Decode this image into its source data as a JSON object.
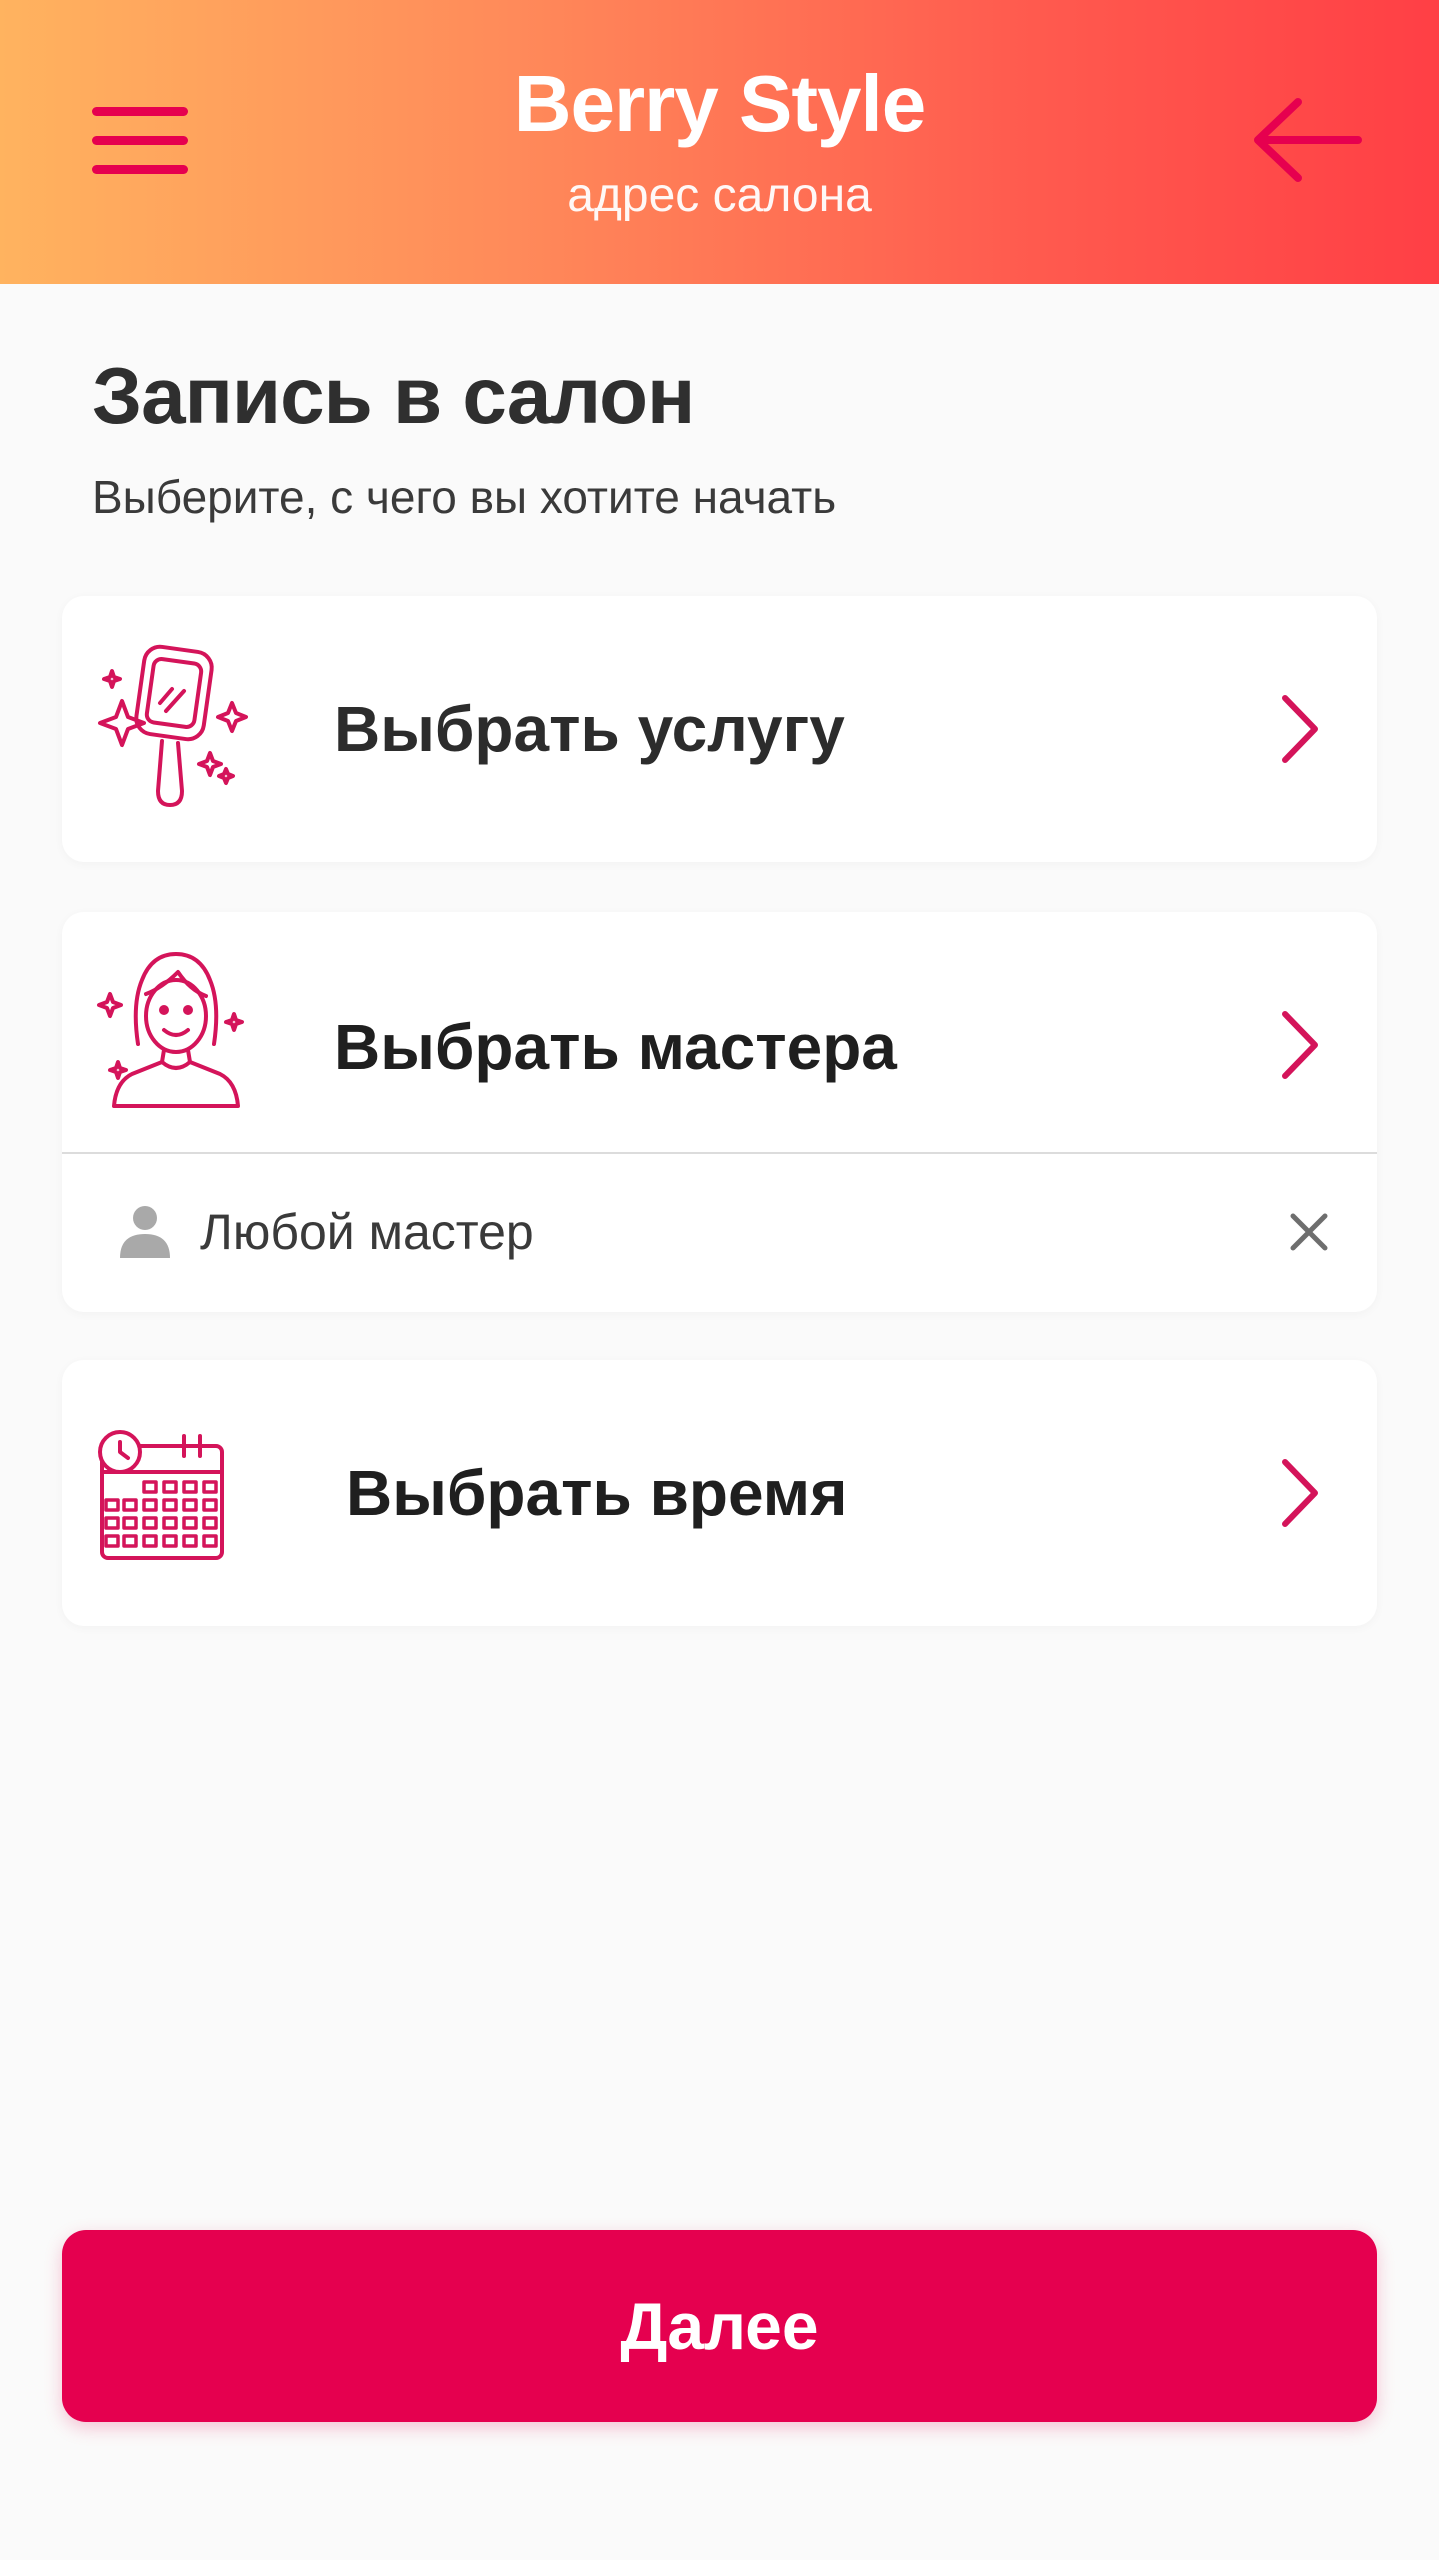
{
  "header": {
    "title": "Berry Style",
    "subtitle": "адрес салона",
    "menu_icon": "hamburger-menu-icon",
    "back_icon": "arrow-left-icon"
  },
  "page": {
    "title": "Запись в салон",
    "subtitle": "Выберите, с чего вы хотите начать"
  },
  "options": [
    {
      "label": "Выбрать услугу",
      "icon": "mirror-sparkles-icon"
    },
    {
      "label": "Выбрать мастера",
      "icon": "woman-portrait-icon",
      "selection": "Любой мастер",
      "selection_icon": "person-icon",
      "clear_icon": "close-icon"
    },
    {
      "label": "Выбрать время",
      "icon": "calendar-clock-icon"
    }
  ],
  "footer": {
    "next_label": "Далее"
  },
  "colors": {
    "accent": "#e5004f",
    "header_gradient_start": "#ffb35f",
    "header_gradient_end": "#ff3f45",
    "background": "#fafafa"
  }
}
